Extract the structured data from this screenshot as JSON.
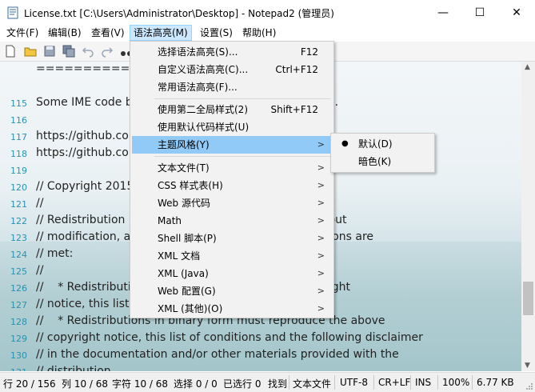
{
  "window": {
    "title": "License.txt [C:\\Users\\Administrator\\Desktop] - Notepad2 (管理员)",
    "minimize": "—",
    "maximize": "☐",
    "close": "✕"
  },
  "menubar": [
    {
      "label": "文件(F)"
    },
    {
      "label": "编辑(B)"
    },
    {
      "label": "查看(V)"
    },
    {
      "label": "语法高亮(M)"
    },
    {
      "label": "设置(S)"
    },
    {
      "label": "帮助(H)"
    }
  ],
  "toolbar_icons": [
    "new-file-icon",
    "open-folder-icon",
    "save-icon",
    "save-all-icon",
    "undo-icon",
    "redo-icon",
    "binoculars-icon"
  ],
  "editor_lines": [
    {
      "num": "",
      "text": "==========="
    },
    {
      "num": "115",
      "text": "Some IME code b                                                 class."
    },
    {
      "num": "116",
      "text": ""
    },
    {
      "num": "117",
      "text": "https://github.co"
    },
    {
      "num": "118",
      "text": "https://github.co"
    },
    {
      "num": "119",
      "text": ""
    },
    {
      "num": "120",
      "text": "// Copyright 2015                                          erved."
    },
    {
      "num": "121",
      "text": "//"
    },
    {
      "num": "122",
      "text": "// Redistribution                                          th or without"
    },
    {
      "num": "123",
      "text": "// modification, a                                         ng conditions are"
    },
    {
      "num": "124",
      "text": "// met:"
    },
    {
      "num": "125",
      "text": "//"
    },
    {
      "num": "126",
      "text": "//    * Redistributi                                        ove copyright"
    },
    {
      "num": "127",
      "text": "// notice, this list                                        imer."
    },
    {
      "num": "128",
      "text": "//    * Redistributions in binary form must reproduce the above"
    },
    {
      "num": "129",
      "text": "// copyright notice, this list of conditions and the following disclaimer"
    },
    {
      "num": "130",
      "text": "// in the documentation and/or other materials provided with the"
    },
    {
      "num": "131",
      "text": "// distribution."
    }
  ],
  "syntax_menu": {
    "items": [
      {
        "label": "选择语法高亮(S)...",
        "shortcut": "F12"
      },
      {
        "label": "自定义语法高亮(C)...",
        "shortcut": "Ctrl+F12"
      },
      {
        "label": "常用语法高亮(F)...",
        "shortcut": ""
      },
      {
        "label": "使用第二全局样式(2)",
        "shortcut": "Shift+F12"
      },
      {
        "label": "使用默认代码样式(U)",
        "shortcut": ""
      },
      {
        "label": "主题风格(Y)",
        "shortcut": "",
        "submenu": true
      },
      {
        "label": "文本文件(T)",
        "shortcut": "",
        "submenu": true
      },
      {
        "label": "CSS 样式表(H)",
        "shortcut": "",
        "submenu": true
      },
      {
        "label": "Web 源代码",
        "shortcut": "",
        "submenu": true
      },
      {
        "label": "Math",
        "shortcut": "",
        "submenu": true
      },
      {
        "label": "Shell 脚本(P)",
        "shortcut": "",
        "submenu": true
      },
      {
        "label": "XML 文档",
        "shortcut": "",
        "submenu": true
      },
      {
        "label": "XML (Java)",
        "shortcut": "",
        "submenu": true
      },
      {
        "label": "Web 配置(G)",
        "shortcut": "",
        "submenu": true
      },
      {
        "label": "XML (其他)(O)",
        "shortcut": "",
        "submenu": true
      }
    ]
  },
  "theme_submenu": {
    "items": [
      {
        "label": "默认(D)",
        "checked": "●"
      },
      {
        "label": "暗色(K)",
        "checked": ""
      }
    ]
  },
  "statusbar": [
    "行 20 / 156",
    "列 10 / 68",
    "字符 10 / 68",
    "选择 0 / 0",
    "已选行 0",
    "找到",
    "文本文件",
    "UTF-8",
    "CR+LF",
    "INS",
    "100%",
    "6.77 KB"
  ],
  "colors": {
    "menu_highlight": "#91c9f7",
    "menubar_active": "#cce8ff",
    "line_number": "#2b91af"
  }
}
